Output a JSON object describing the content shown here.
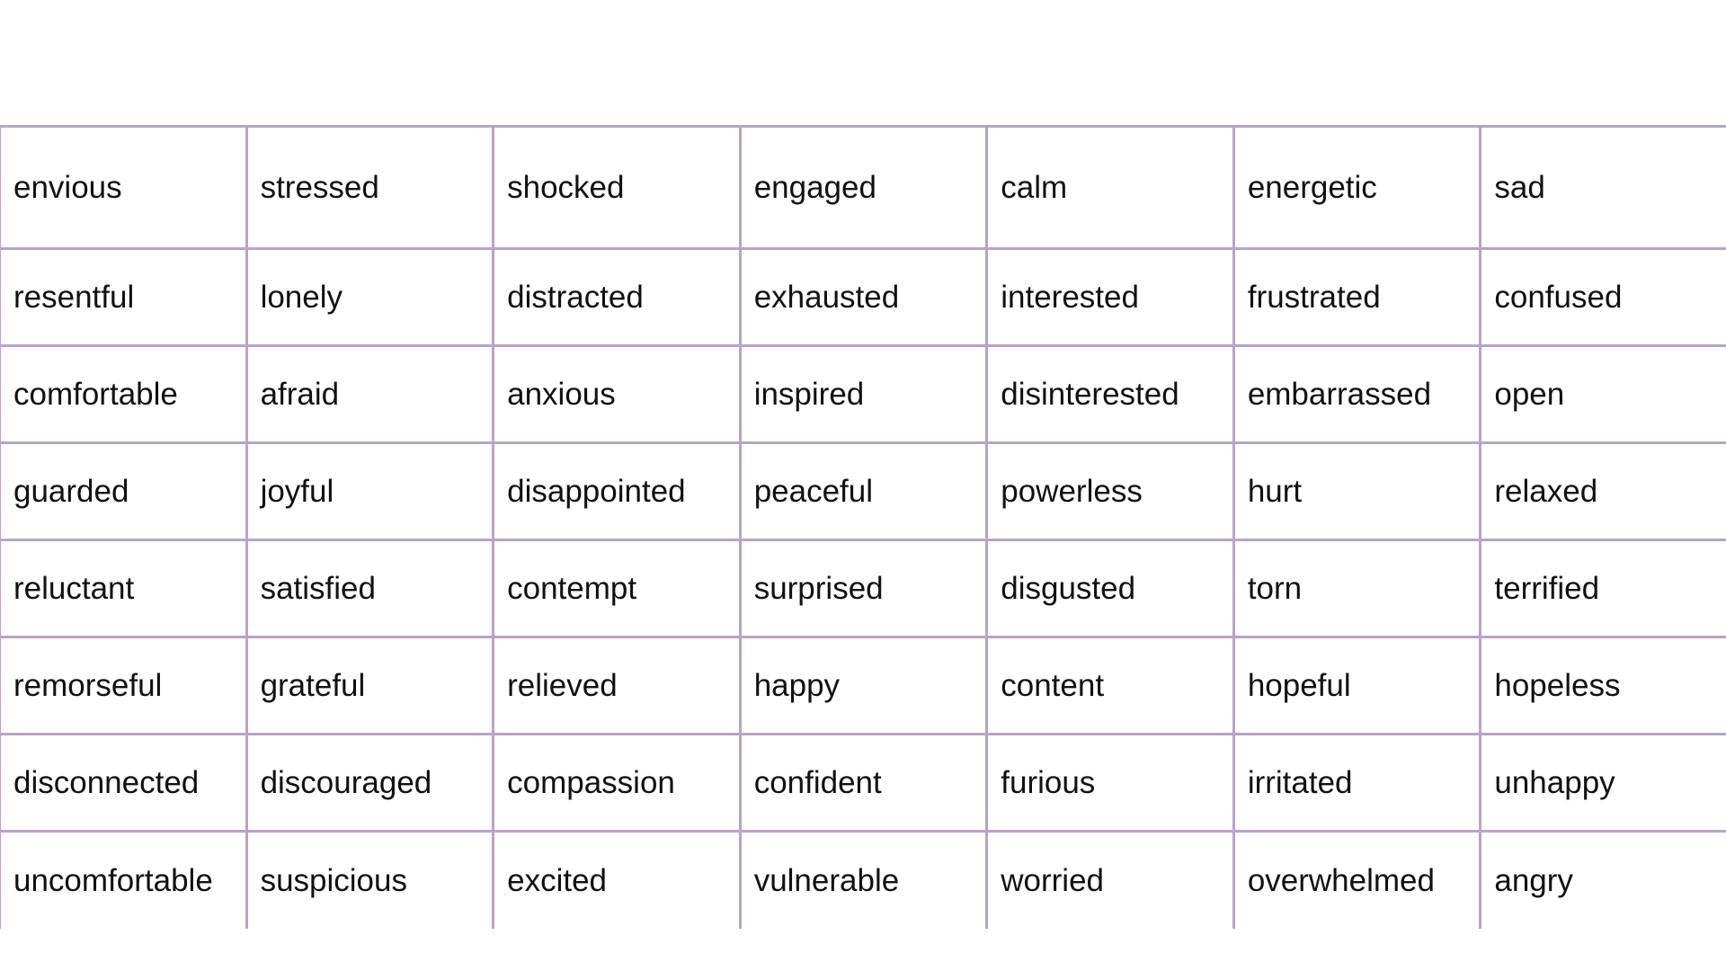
{
  "colors": {
    "grid_line": "#b9a3c9",
    "text": "#111111",
    "background": "#ffffff"
  },
  "table": {
    "rows": [
      [
        "envious",
        "stressed",
        "shocked",
        "engaged",
        "calm",
        "energetic",
        "sad"
      ],
      [
        "resentful",
        "lonely",
        "distracted",
        "exhausted",
        "interested",
        "frustrated",
        "confused"
      ],
      [
        "comfortable",
        "afraid",
        "anxious",
        "inspired",
        "disinterested",
        "embarrassed",
        "open"
      ],
      [
        "guarded",
        "joyful",
        "disappointed",
        "peaceful",
        "powerless",
        "hurt",
        "relaxed"
      ],
      [
        "reluctant",
        "satisfied",
        "contempt",
        "surprised",
        "disgusted",
        "torn",
        "terrified"
      ],
      [
        "remorseful",
        "grateful",
        "relieved",
        "happy",
        "content",
        "hopeful",
        "hopeless"
      ],
      [
        "disconnected",
        "discouraged",
        "compassion",
        "confident",
        "furious",
        "irritated",
        "unhappy"
      ],
      [
        "uncomfortable",
        "suspicious",
        "excited",
        "vulnerable",
        "worried",
        "overwhelmed",
        "angry"
      ]
    ]
  }
}
